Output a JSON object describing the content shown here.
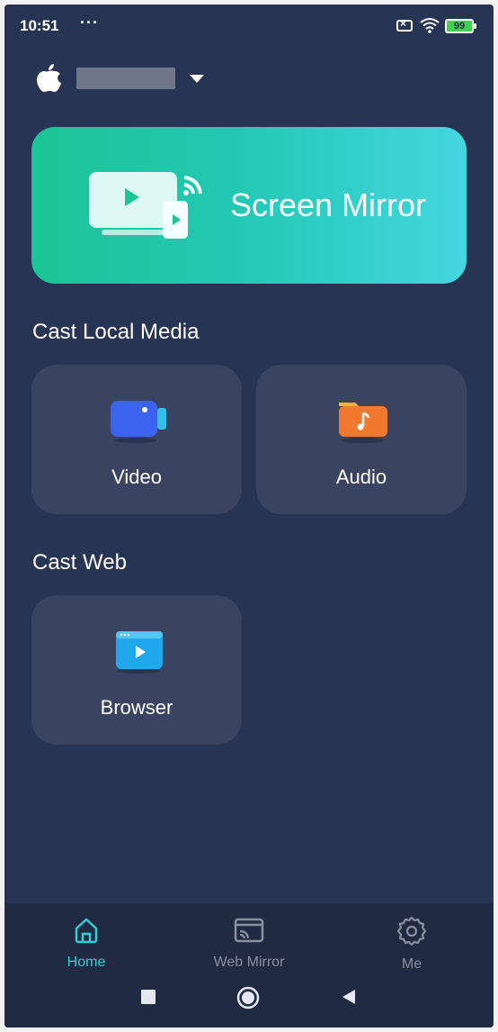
{
  "status_bar": {
    "time": "10:51",
    "dots": "···",
    "battery": "99"
  },
  "device": {
    "name": ""
  },
  "banner": {
    "title": "Screen Mirror"
  },
  "sections": {
    "local": {
      "title": "Cast Local Media",
      "video_label": "Video",
      "audio_label": "Audio"
    },
    "web": {
      "title": "Cast Web",
      "browser_label": "Browser"
    }
  },
  "nav": {
    "home": "Home",
    "web_mirror": "Web Mirror",
    "me": "Me"
  },
  "colors": {
    "background": "#283453",
    "accent": "#2ed0d1",
    "tile": "#3a4460"
  }
}
